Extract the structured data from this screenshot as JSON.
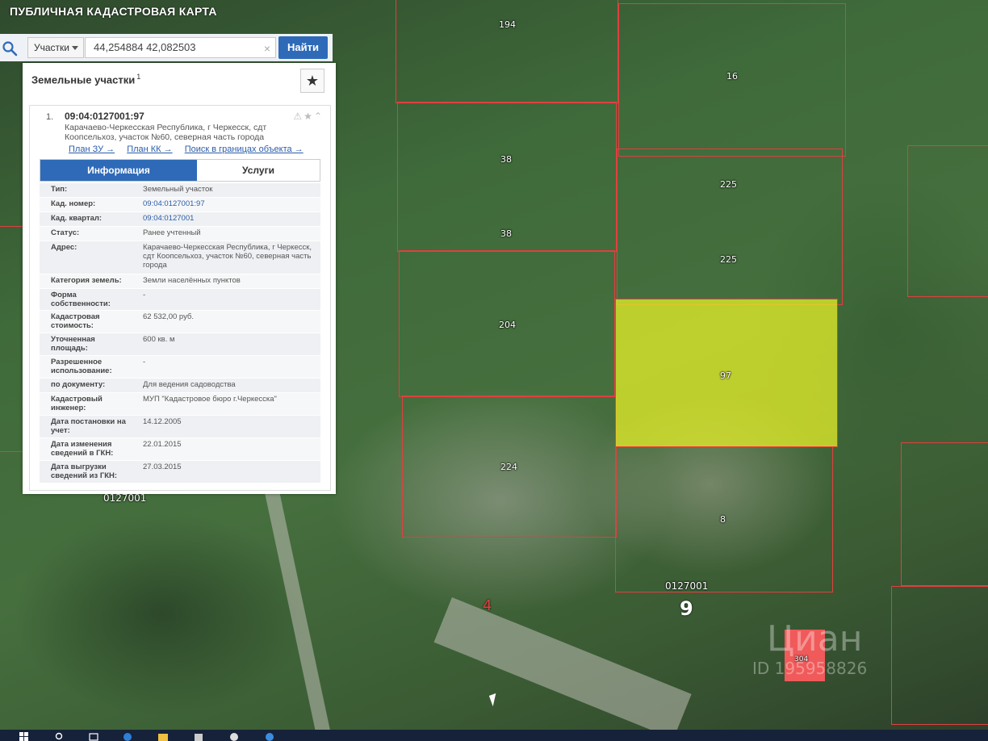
{
  "app": {
    "title": "ПУБЛИЧНАЯ КАДАСТРОВАЯ КАРТА"
  },
  "search": {
    "type_select": "Участки",
    "query": "44,254884 42,082503",
    "button": "Найти"
  },
  "panel": {
    "title": "Земельные участки",
    "count": "1",
    "result": {
      "number": "1.",
      "id": "09:04:0127001:97",
      "address": "Карачаево-Черкесская Республика, г Черкесск, сдт Коопсельхоз, участок №60, северная часть города",
      "links": [
        "План ЗУ →",
        "План КК →",
        "Поиск в границах объекта →"
      ]
    },
    "tabs": [
      "Информация",
      "Услуги"
    ],
    "rows": [
      {
        "label": "Тип:",
        "value": "Земельный участок"
      },
      {
        "label": "Кад. номер:",
        "value": "09:04:0127001:97"
      },
      {
        "label": "Кад. квартал:",
        "value": "09:04:0127001"
      },
      {
        "label": "Статус:",
        "value": "Ранее учтенный"
      },
      {
        "label": "Адрес:",
        "value": "Карачаево-Черкесская Республика, г Черкесск, сдт Коопсельхоз, участок №60, северная часть города"
      },
      {
        "label": "Категория земель:",
        "value": "Земли населённых пунктов"
      },
      {
        "label": "Форма собственности:",
        "value": "-"
      },
      {
        "label": "Кадастровая стоимость:",
        "value": "62 532,00 руб."
      },
      {
        "label": "Уточненная площадь:",
        "value": "600 кв. м"
      },
      {
        "label": "Разрешенное использование:",
        "value": "-"
      },
      {
        "label": "по документу:",
        "value": "Для ведения садоводства"
      },
      {
        "label": "Кадастровый инженер:",
        "value": "МУП \"Кадастровое бюро г.Черкесска\""
      },
      {
        "label": "Дата постановки на учет:",
        "value": "14.12.2005"
      },
      {
        "label": "Дата изменения сведений в ГКН:",
        "value": "22.01.2015"
      },
      {
        "label": "Дата выгрузки сведений из ГКН:",
        "value": "27.03.2015"
      }
    ]
  },
  "map": {
    "parcel_labels": [
      "194",
      "16",
      "38",
      "38",
      "225",
      "225",
      "204",
      "97",
      "224",
      "8",
      "304"
    ],
    "quarter_labels": [
      "0127001",
      "0127001"
    ],
    "block_numbers": [
      "4",
      "9"
    ],
    "watermark": "Циан",
    "watermark_id": "ID 195958826",
    "colors": {
      "boundary": "#e04040",
      "selected": "#e6f028",
      "marker": "#f05a5a"
    }
  }
}
